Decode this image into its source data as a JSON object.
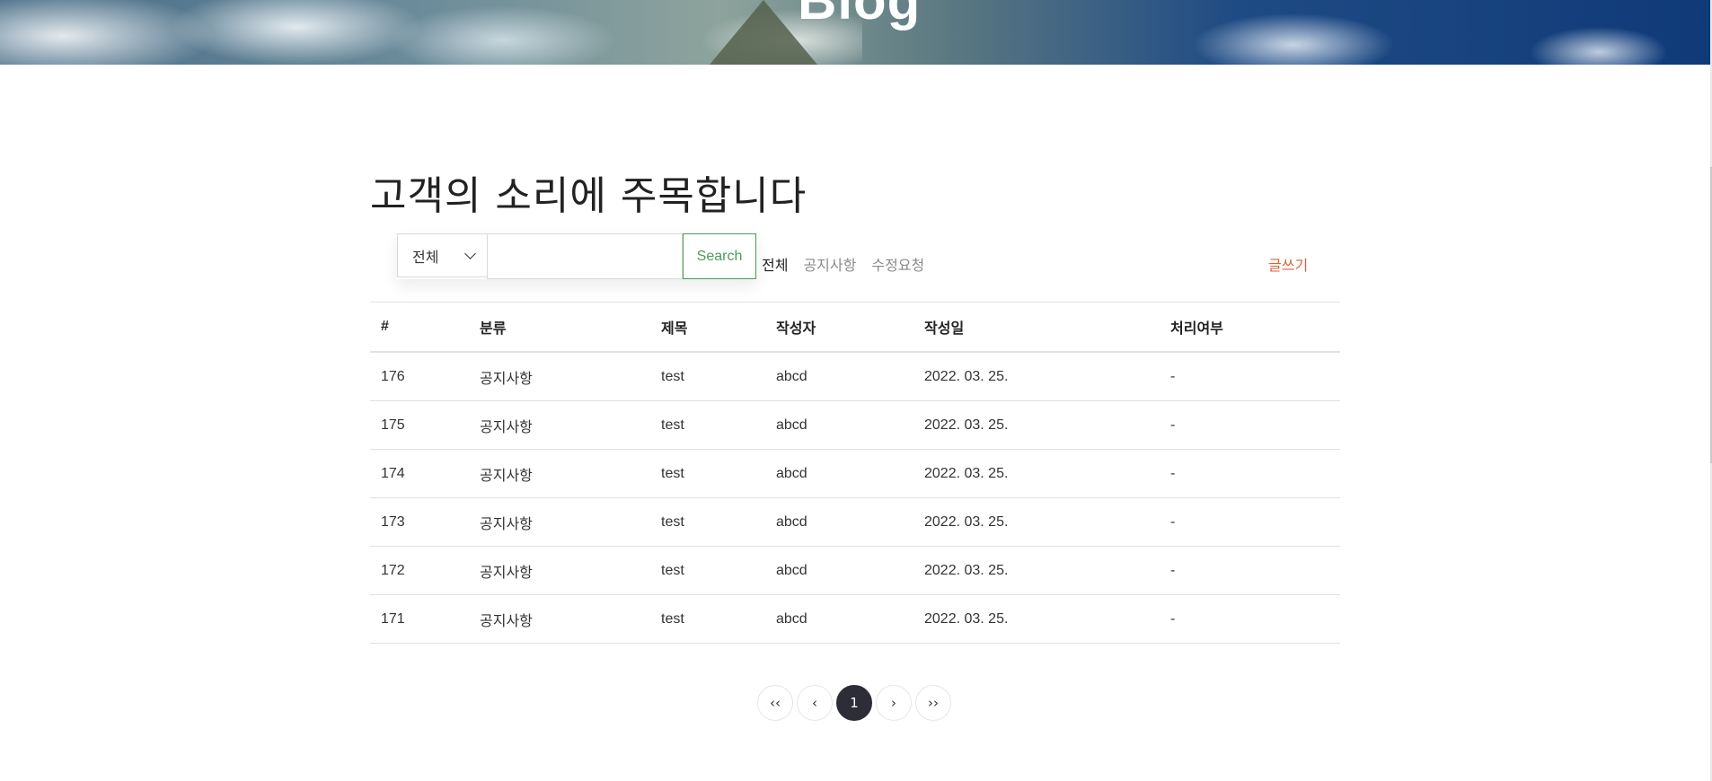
{
  "hero": {
    "title": "Blog"
  },
  "page": {
    "heading": "고객의 소리에 주목합니다"
  },
  "search": {
    "category_selected": "전체",
    "input_value": "",
    "input_placeholder": "",
    "button_label": "Search"
  },
  "filters": [
    {
      "label": "전체",
      "active": true
    },
    {
      "label": "공지사항",
      "active": false
    },
    {
      "label": "수정요청",
      "active": false
    }
  ],
  "write_label": "글쓰기",
  "colors": {
    "accent_green": "#4a9d58",
    "write_orange": "#d9623a",
    "pager_active": "#2d2d38"
  },
  "table": {
    "headers": [
      "#",
      "분류",
      "제목",
      "작성자",
      "작성일",
      "처리여부"
    ],
    "rows": [
      [
        "176",
        "공지사항",
        "test",
        "abcd",
        "2022. 03. 25.",
        "-"
      ],
      [
        "175",
        "공지사항",
        "test",
        "abcd",
        "2022. 03. 25.",
        "-"
      ],
      [
        "174",
        "공지사항",
        "test",
        "abcd",
        "2022. 03. 25.",
        "-"
      ],
      [
        "173",
        "공지사항",
        "test",
        "abcd",
        "2022. 03. 25.",
        "-"
      ],
      [
        "172",
        "공지사항",
        "test",
        "abcd",
        "2022. 03. 25.",
        "-"
      ],
      [
        "171",
        "공지사항",
        "test",
        "abcd",
        "2022. 03. 25.",
        "-"
      ]
    ]
  },
  "pagination": {
    "first": "‹‹",
    "prev": "‹",
    "current": "1",
    "next": "›",
    "last": "››"
  }
}
